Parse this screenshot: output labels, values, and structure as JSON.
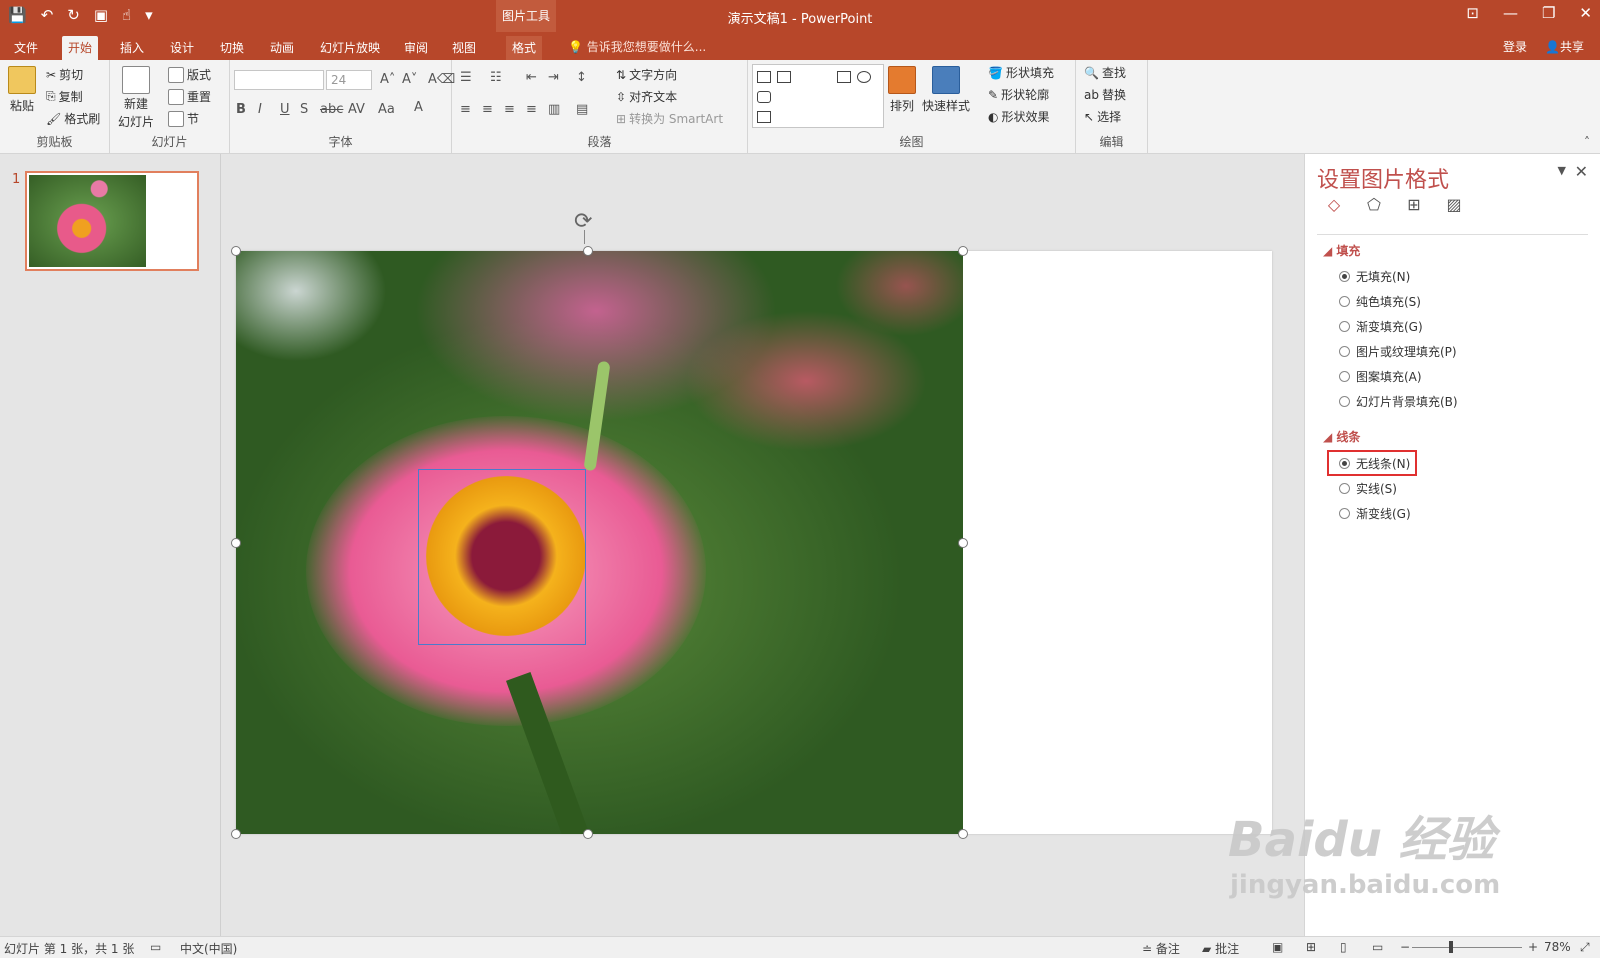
{
  "app": {
    "doc_title": "演示文稿1 - PowerPoint",
    "context_tab": "图片工具"
  },
  "tabs": [
    "文件",
    "开始",
    "插入",
    "设计",
    "切换",
    "动画",
    "幻灯片放映",
    "审阅",
    "视图",
    "格式"
  ],
  "tell_me": "告诉我您想要做什么...",
  "user": {
    "login": "登录",
    "share": "共享"
  },
  "ribbon": {
    "clipboard": {
      "label": "剪贴板",
      "paste": "粘贴",
      "cut": "剪切",
      "copy": "复制",
      "format_painter": "格式刷"
    },
    "slides": {
      "label": "幻灯片",
      "new_slide": "新建",
      "new_slide2": "幻灯片",
      "layout": "版式",
      "reset": "重置",
      "section": "节"
    },
    "font": {
      "label": "字体",
      "size": "24"
    },
    "paragraph": {
      "label": "段落",
      "text_direction": "文字方向",
      "align_text": "对齐文本",
      "smartart": "转换为 SmartArt"
    },
    "drawing": {
      "label": "绘图",
      "arrange": "排列",
      "quick_styles": "快速样式",
      "shape_fill": "形状填充",
      "shape_outline": "形状轮廓",
      "shape_effects": "形状效果"
    },
    "editing": {
      "label": "编辑",
      "find": "查找",
      "replace": "替换",
      "select": "选择"
    }
  },
  "slides_pane": {
    "slide_number": "1"
  },
  "format_pane": {
    "title": "设置图片格式",
    "fill_section": "填充",
    "fill_options": [
      "无填充(N)",
      "纯色填充(S)",
      "渐变填充(G)",
      "图片或纹理填充(P)",
      "图案填充(A)",
      "幻灯片背景填充(B)"
    ],
    "line_section": "线条",
    "line_options": [
      "无线条(N)",
      "实线(S)",
      "渐变线(G)"
    ]
  },
  "statusbar": {
    "slide_info": "幻灯片 第 1 张，共 1 张",
    "language": "中文(中国)",
    "notes": "备注",
    "comments": "批注",
    "zoom": "78%"
  },
  "watermark": {
    "big": "Baidu 经验",
    "small": "jingyan.baidu.com"
  }
}
